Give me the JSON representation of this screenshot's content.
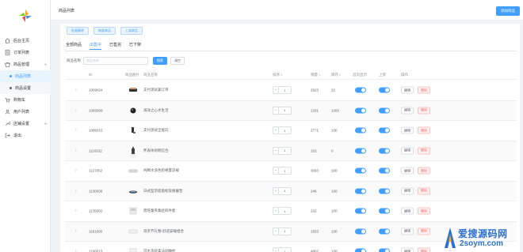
{
  "sidebar": {
    "items": [
      {
        "label": "后台主页",
        "icon": "home-icon"
      },
      {
        "label": "订单列表",
        "icon": "list-icon"
      },
      {
        "label": "商品管理",
        "icon": "shop-icon"
      },
      {
        "label": "商品列表",
        "icon": "dot-icon"
      },
      {
        "label": "商品设置",
        "icon": "dot-icon"
      },
      {
        "label": "购物车",
        "icon": "cart-icon"
      },
      {
        "label": "用户列表",
        "icon": "users-icon"
      },
      {
        "label": "店铺设置",
        "icon": "wrench-icon"
      },
      {
        "label": "退出",
        "icon": "exit-icon"
      }
    ]
  },
  "header": {
    "title": "商品列表",
    "add_label": "添加商品"
  },
  "actions": [
    "批量删除",
    "恢复商品",
    "上架商品"
  ],
  "tabs": [
    {
      "label": "全部商品",
      "active": false
    },
    {
      "label": "出售中",
      "active": true
    },
    {
      "label": "已售完",
      "active": false
    },
    {
      "label": "已下架",
      "active": false
    }
  ],
  "search": {
    "label": "商品名称",
    "placeholder": "商品名称",
    "query_label": "搜索",
    "reset_label": "清空"
  },
  "table": {
    "headers": {
      "id": "ID",
      "image": "商品图片",
      "name": "商品名称",
      "sort": "排序",
      "sales": "销量",
      "stock": "库存",
      "home": "首页显示",
      "onsale": "上架",
      "ops": "操作"
    },
    "edit_label": "编辑",
    "delete_label": "删除",
    "rows": [
      {
        "id": "1009024",
        "name": "支付测试兼订单",
        "qty": "1",
        "sales": "2923",
        "stock": "22"
      },
      {
        "id": "1083009",
        "name": "海洋之心水生活",
        "qty": "1",
        "sales": "1331",
        "stock": "1000"
      },
      {
        "id": "1086015",
        "name": "支付测试全能向",
        "qty": "1",
        "sales": "2771",
        "stock": "100"
      },
      {
        "id": "1116032",
        "name": "怀表体闲明信合",
        "qty": "1",
        "sales": "102",
        "stock": "0"
      },
      {
        "id": "1127052",
        "name": "纯棉水洗色织格夏凉被",
        "qty": "1",
        "sales": "3093",
        "stock": "100"
      },
      {
        "id": "1130038",
        "name": "日式型宗底盘松饭格餐垫",
        "qty": "1",
        "sales": "246",
        "stock": "100"
      },
      {
        "id": "1135002",
        "name": "而旺童夹集娃四件套",
        "qty": "1",
        "sales": "232",
        "stock": "100"
      },
      {
        "id": "1181000",
        "name": "母亲节礼物-舒适安睡组合",
        "qty": "1",
        "sales": "1553",
        "stock": "100"
      },
      {
        "id": "1190013",
        "name": "可水洗舒柔法动睡枕",
        "qty": "1",
        "sales": "4802",
        "stock": "100"
      }
    ]
  },
  "watermark": {
    "line1": "爱搜源码网",
    "line2": "2soym.com"
  },
  "colors": {
    "accent": "#409eff",
    "danger": "#f56c6c"
  }
}
